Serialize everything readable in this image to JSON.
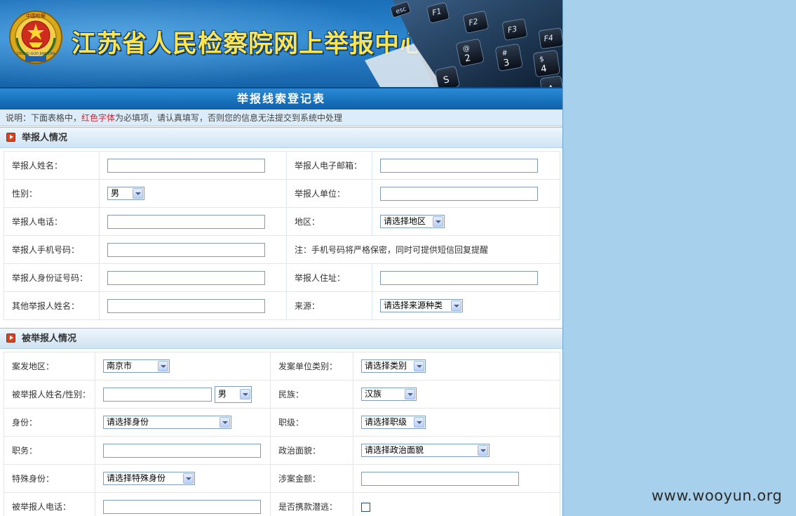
{
  "header": {
    "site_title": "江苏省人民检察院网上举报中心",
    "emblem_icon": "procuratorate-emblem-icon",
    "emblem_text_top": "中国检察",
    "emblem_text_bottom": "ZHONG GUO JIAN CHA",
    "keyboard_keys": [
      "esc",
      "F1",
      "F2",
      "F3",
      "F4",
      "2",
      "3",
      "4",
      "@",
      "#",
      "$",
      "S",
      "A"
    ]
  },
  "form_title": "举报线索登记表",
  "notice": {
    "prefix": "说明：下面表格中，",
    "red_text": "红色字体",
    "suffix": "为必填项，请认真填写，否则您的信息无法提交到系统中处理"
  },
  "reporter_section": {
    "title": "举报人情况",
    "name_label": "举报人姓名：",
    "email_label": "举报人电子邮箱：",
    "gender_label": "性别：",
    "gender_value": "男",
    "employer_label": "举报人单位：",
    "phone_label": "举报人电话：",
    "region_label": "地区：",
    "region_value": "请选择地区",
    "mobile_label": "举报人手机号码：",
    "mobile_note": "注：手机号码将严格保密，同时可提供短信回复提醒",
    "id_label": "举报人身份证号码：",
    "address_label": "举报人住址：",
    "other_names_label": "其他举报人姓名：",
    "source_label": "来源：",
    "source_value": "请选择来源种类"
  },
  "accused_section": {
    "title": "被举报人情况",
    "case_region_label": "案发地区：",
    "case_region_value": "南京市",
    "unit_type_label": "发案单位类别：",
    "unit_type_value": "请选择类别",
    "name_gender_label": "被举报人姓名/性别：",
    "gender_value": "男",
    "ethnicity_label": "民族：",
    "ethnicity_value": "汉族",
    "identity_label": "身份：",
    "identity_value": "请选择身份",
    "rank_label": "职级：",
    "rank_value": "请选择职级",
    "position_label": "职务：",
    "political_label": "政治面貌：",
    "political_value": "请选择政治面貌",
    "special_identity_label": "特殊身份：",
    "special_identity_value": "请选择特殊身份",
    "amount_label": "涉案金额：",
    "phone_label": "被举报人电话：",
    "fled_label": "是否携款潜逃："
  },
  "watermark": "www.wooyun.org",
  "colors": {
    "required_red": "#e0202e",
    "title_yellow": "#ffe44d",
    "banner_blue": "#1a6fb8",
    "side_background": "#a6d0eb"
  }
}
